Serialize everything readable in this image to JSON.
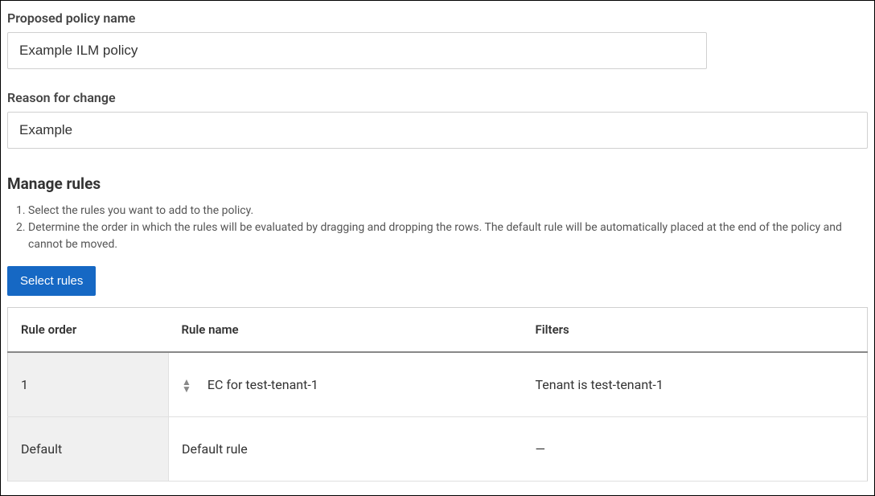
{
  "policyName": {
    "label": "Proposed policy name",
    "value": "Example ILM policy"
  },
  "reason": {
    "label": "Reason for change",
    "value": "Example"
  },
  "manageRules": {
    "heading": "Manage rules",
    "instructions": [
      "Select the rules you want to add to the policy.",
      "Determine the order in which the rules will be evaluated by dragging and dropping the rows. The default rule will be automatically placed at the end of the policy and cannot be moved."
    ],
    "selectButton": "Select rules"
  },
  "table": {
    "headers": {
      "order": "Rule order",
      "name": "Rule name",
      "filters": "Filters"
    },
    "rows": [
      {
        "order": "1",
        "name": "EC for test-tenant-1",
        "filters": "Tenant is test-tenant-1",
        "draggable": true
      },
      {
        "order": "Default",
        "name": "Default rule",
        "filters": "—",
        "draggable": false
      }
    ]
  }
}
